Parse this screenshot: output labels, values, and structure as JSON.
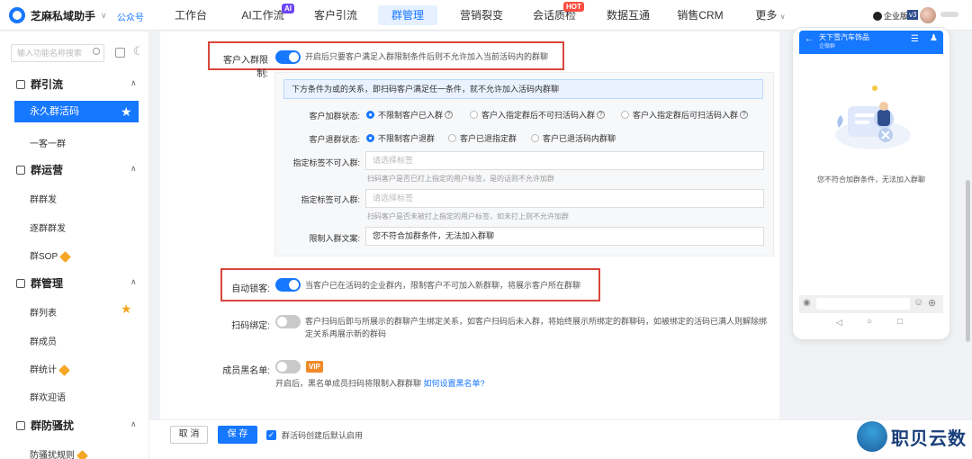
{
  "app": {
    "name": "芝麻私域助手",
    "account_type": "公众号"
  },
  "nav": {
    "items": [
      {
        "label": "工作台"
      },
      {
        "label": "AI工作流",
        "badge": "AI"
      },
      {
        "label": "客户引流"
      },
      {
        "label": "群管理",
        "active": true
      },
      {
        "label": "营销裂变"
      },
      {
        "label": "会话质检",
        "badge": "HOT"
      },
      {
        "label": "数据互通"
      },
      {
        "label": "销售CRM"
      },
      {
        "label": "更多"
      }
    ]
  },
  "user": {
    "edition": "企业版",
    "version": "v3"
  },
  "sidebar": {
    "search_placeholder": "输入功能名称搜索",
    "groups": [
      {
        "title": "群引流",
        "items": [
          "永久群活码",
          "一客一群"
        ]
      },
      {
        "title": "群运营",
        "items": [
          "群群发",
          "逐群群发",
          "群SOP"
        ]
      },
      {
        "title": "群管理",
        "items": [
          "群列表",
          "群成员",
          "群统计",
          "群欢迎语"
        ]
      },
      {
        "title": "群防骚扰",
        "items": [
          "防骚扰规则"
        ]
      }
    ]
  },
  "form": {
    "join_limit": {
      "label": "客户入群限制:",
      "enabled": true,
      "desc": "开启后只要客户满足入群限制条件后则不允许加入当前活码内的群聊"
    },
    "info": "下方条件为或的关系，即扫码客户满足任一条件，就不允许加入活码内群聊",
    "join_status": {
      "label": "客户加群状态:",
      "options": [
        "不限制客户已入群",
        "客户入指定群后不可扫活码入群",
        "客户入指定群后可扫活码入群"
      ],
      "selected": 0
    },
    "quit_status": {
      "label": "客户退群状态:",
      "options": [
        "不限制客户退群",
        "客户已退指定群",
        "客户已退活码内群聊"
      ],
      "selected": 0
    },
    "tag_block": {
      "label": "指定标签不可入群:",
      "placeholder": "请选择标签",
      "hint": "扫码客户是否已打上指定的用户标签，是的话则不允许加群"
    },
    "tag_allow": {
      "label": "指定标签可入群:",
      "placeholder": "请选择标签",
      "hint": "扫码客户是否未被打上指定的用户标签，如未打上则不允许加群"
    },
    "limit_text": {
      "label": "限制入群文案:",
      "value": "您不符合加群条件，无法加入群聊"
    },
    "auto_lock": {
      "label": "自动锁客:",
      "enabled": true,
      "desc": "当客户已在活码的企业群内，限制客户不可加入新群聊，将展示客户所在群聊"
    },
    "scan_bind": {
      "label": "扫码绑定:",
      "enabled": false,
      "desc1": "客户扫码后即与所展示的群聊产生绑定关系，如客户扫码后未入群，将始终展示所绑定的群聊码，如被绑定的活码已满人则解除绑",
      "desc2": "定关系再展示新的群码"
    },
    "blacklist": {
      "label": "成员黑名单:",
      "enabled": false,
      "vip": "VIP",
      "desc": "开启后，黑名单成员扫码将限制入群群聊",
      "link": "如何设置黑名单?"
    }
  },
  "phone": {
    "title": "天下雪汽车饰品",
    "subtitle": "企微群",
    "message": "您不符合加群条件，无法加入群聊"
  },
  "footer": {
    "cancel": "取 消",
    "save": "保 存",
    "checkbox_label": "群活码创建后默认启用",
    "checked": true
  },
  "brand": {
    "name": "职贝云数"
  },
  "colors": {
    "accent": "#1677ff",
    "highlight": "#d9463c"
  }
}
